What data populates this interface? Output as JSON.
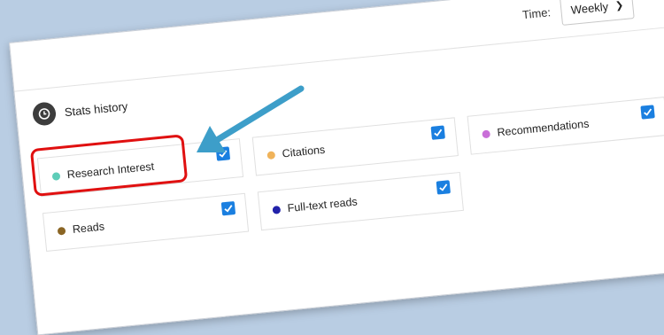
{
  "time": {
    "label": "Time:",
    "selected": "Weekly"
  },
  "stats": {
    "title": "Stats history"
  },
  "metrics": [
    {
      "label": "Research Interest",
      "color": "#5ecdb8",
      "checked": true,
      "highlighted": true
    },
    {
      "label": "Citations",
      "color": "#f0b35a",
      "checked": true
    },
    {
      "label": "Recommendations",
      "color": "#c96fd8",
      "checked": true
    },
    {
      "label": "Reads",
      "color": "#8a6524",
      "checked": true
    },
    {
      "label": "Full-text reads",
      "color": "#2222aa",
      "checked": true
    }
  ],
  "colors": {
    "checkbox": "#1a7fe0",
    "highlight": "#e01010",
    "arrow": "#3d9ec9"
  }
}
